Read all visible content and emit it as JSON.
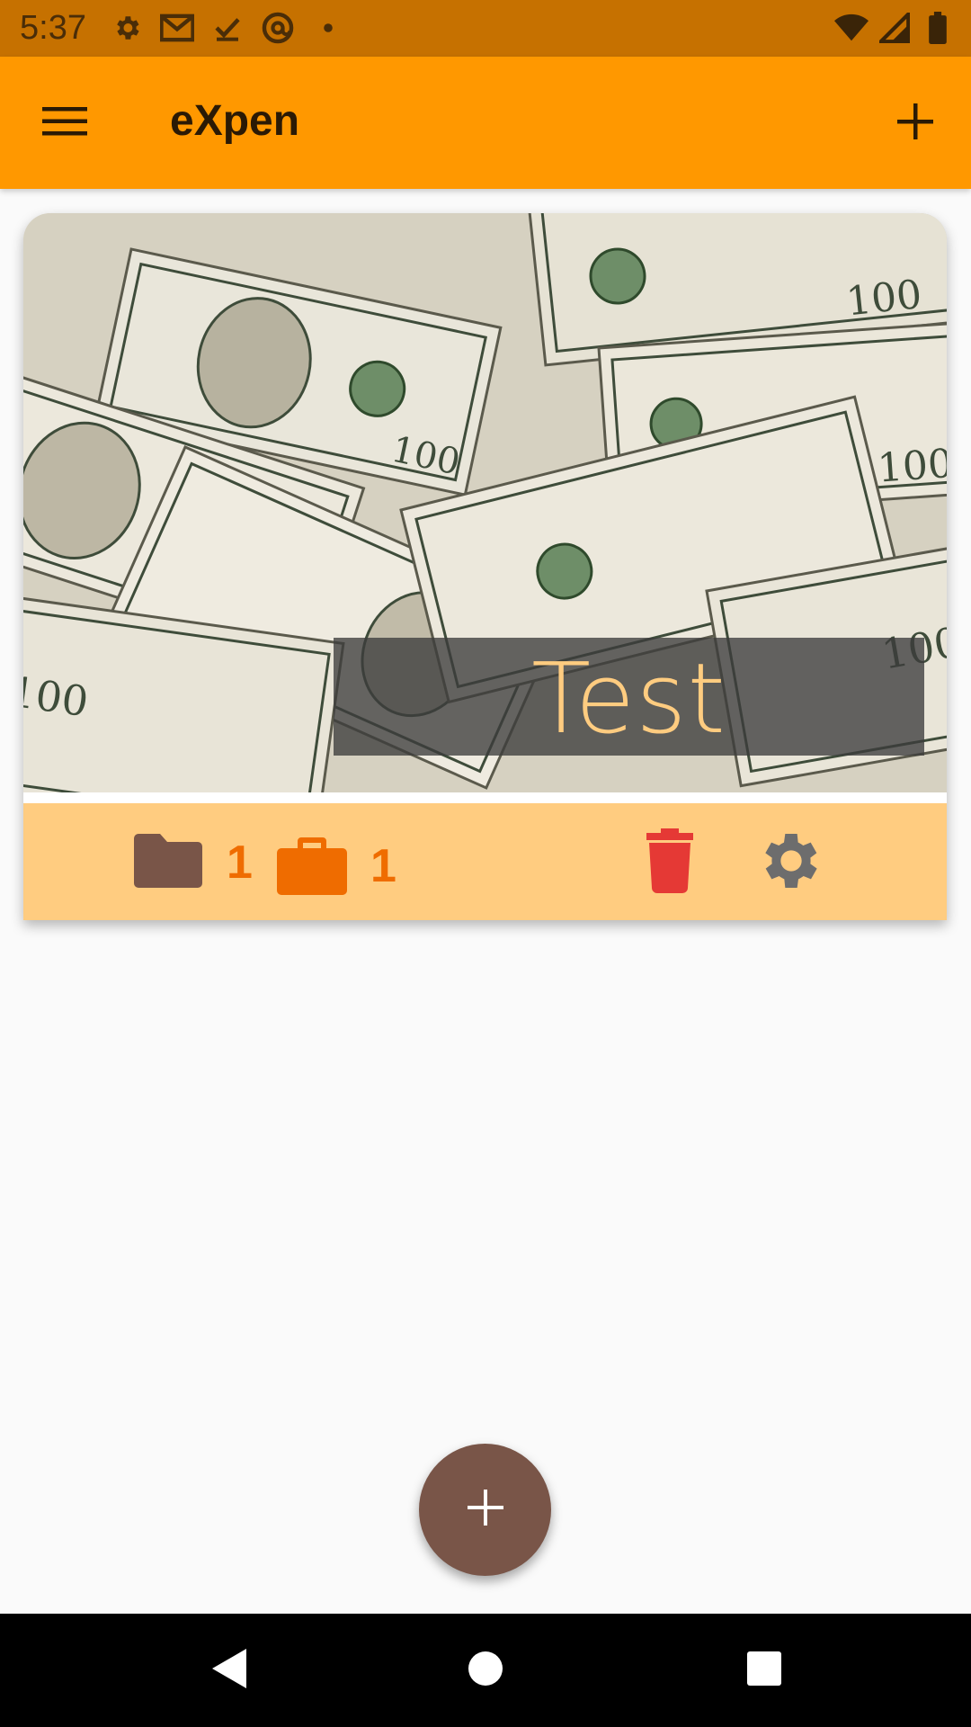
{
  "status_bar": {
    "time": "5:37",
    "left_icons": [
      "gear-icon",
      "gmail-icon",
      "checkmark-icon",
      "at-sign-icon",
      "dot-icon"
    ],
    "right_icons": [
      "wifi-icon",
      "signal-icon",
      "battery-icon"
    ]
  },
  "app_bar": {
    "title": "eXpen",
    "menu_icon": "hamburger-menu-icon",
    "add_icon": "plus-icon"
  },
  "card": {
    "image": "dollar-bills-image",
    "title": "Test",
    "folders_count": "1",
    "briefcase_count": "1",
    "colors": {
      "footer": "#ffcc80",
      "folder_icon": "#795548",
      "briefcase_icon": "#ef6c00",
      "trash_icon": "#e53935",
      "settings_icon": "#6d6d6d"
    }
  },
  "fab": {
    "icon": "plus-icon",
    "color": "#795548"
  },
  "nav_bar": {
    "buttons": [
      "back-icon",
      "home-icon",
      "recents-icon"
    ]
  },
  "colors": {
    "app_bar": "#ff9800",
    "status_bar": "#c67100",
    "accent": "#ef6c00"
  }
}
